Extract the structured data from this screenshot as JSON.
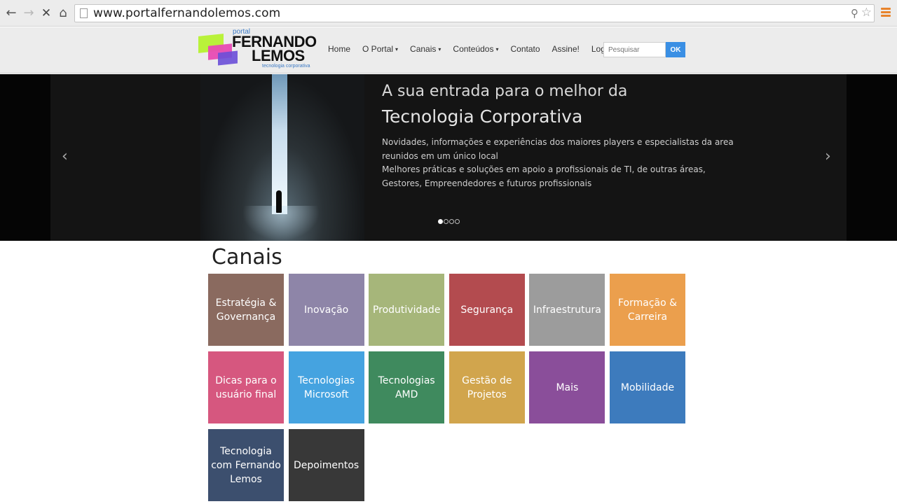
{
  "browser": {
    "url": "www.portalfernandolemos.com",
    "buttons": {
      "back": "←",
      "forward": "→",
      "stop": "✕",
      "home": "⌂"
    }
  },
  "header": {
    "logo": {
      "small": "portal",
      "line1": "FERNANDO",
      "line2": "LEMOS",
      "tagline": "tecnologia corporativa"
    },
    "menu": [
      {
        "label": "Home",
        "dropdown": false
      },
      {
        "label": "O Portal",
        "dropdown": true
      },
      {
        "label": "Canais",
        "dropdown": true
      },
      {
        "label": "Conteúdos",
        "dropdown": true
      },
      {
        "label": "Contato",
        "dropdown": false
      },
      {
        "label": "Assine!",
        "dropdown": false
      },
      {
        "label": "Login",
        "dropdown": false
      }
    ],
    "search": {
      "placeholder": "Pesquisar",
      "button_label": "OK"
    }
  },
  "hero": {
    "title_line1": "A sua entrada para o melhor da",
    "title_line2": "Tecnologia Corporativa",
    "body_lines": [
      "Novidades, informações e experiências dos maiores players e especialistas da area",
      "reunidos em um único local",
      "Melhores práticas e soluções em apoio a profissionais de TI, de outras áreas,",
      "Gestores, Empreendedores e futuros profissionais"
    ],
    "prev": "‹",
    "next": "›",
    "slide_count": 4,
    "active_slide": 1
  },
  "channels": {
    "title": "Canais",
    "tiles": [
      {
        "label": "Estratégia & Governança",
        "color": "#8a6a5f"
      },
      {
        "label": "Inovação",
        "color": "#8e85a8"
      },
      {
        "label": "Produtividade",
        "color": "#a6b67a"
      },
      {
        "label": "Segurança",
        "color": "#b34b4f"
      },
      {
        "label": "Infraestrutura",
        "color": "#9c9c9c"
      },
      {
        "label": "Formação & Carreira",
        "color": "#eb9f4d"
      },
      {
        "label": "Dicas para o usuário final",
        "color": "#d6577f"
      },
      {
        "label": "Tecnologias Microsoft",
        "color": "#45a3e0"
      },
      {
        "label": "Tecnologias AMD",
        "color": "#3f8a5e"
      },
      {
        "label": "Gestão de Projetos",
        "color": "#d1a54d"
      },
      {
        "label": "Mais",
        "color": "#8a4e9a"
      },
      {
        "label": "Mobilidade",
        "color": "#3d7bbd"
      },
      {
        "label": "Tecnologia com Fernando Lemos",
        "color": "#3c4f6e"
      },
      {
        "label": "Depoimentos",
        "color": "#383838"
      }
    ]
  }
}
